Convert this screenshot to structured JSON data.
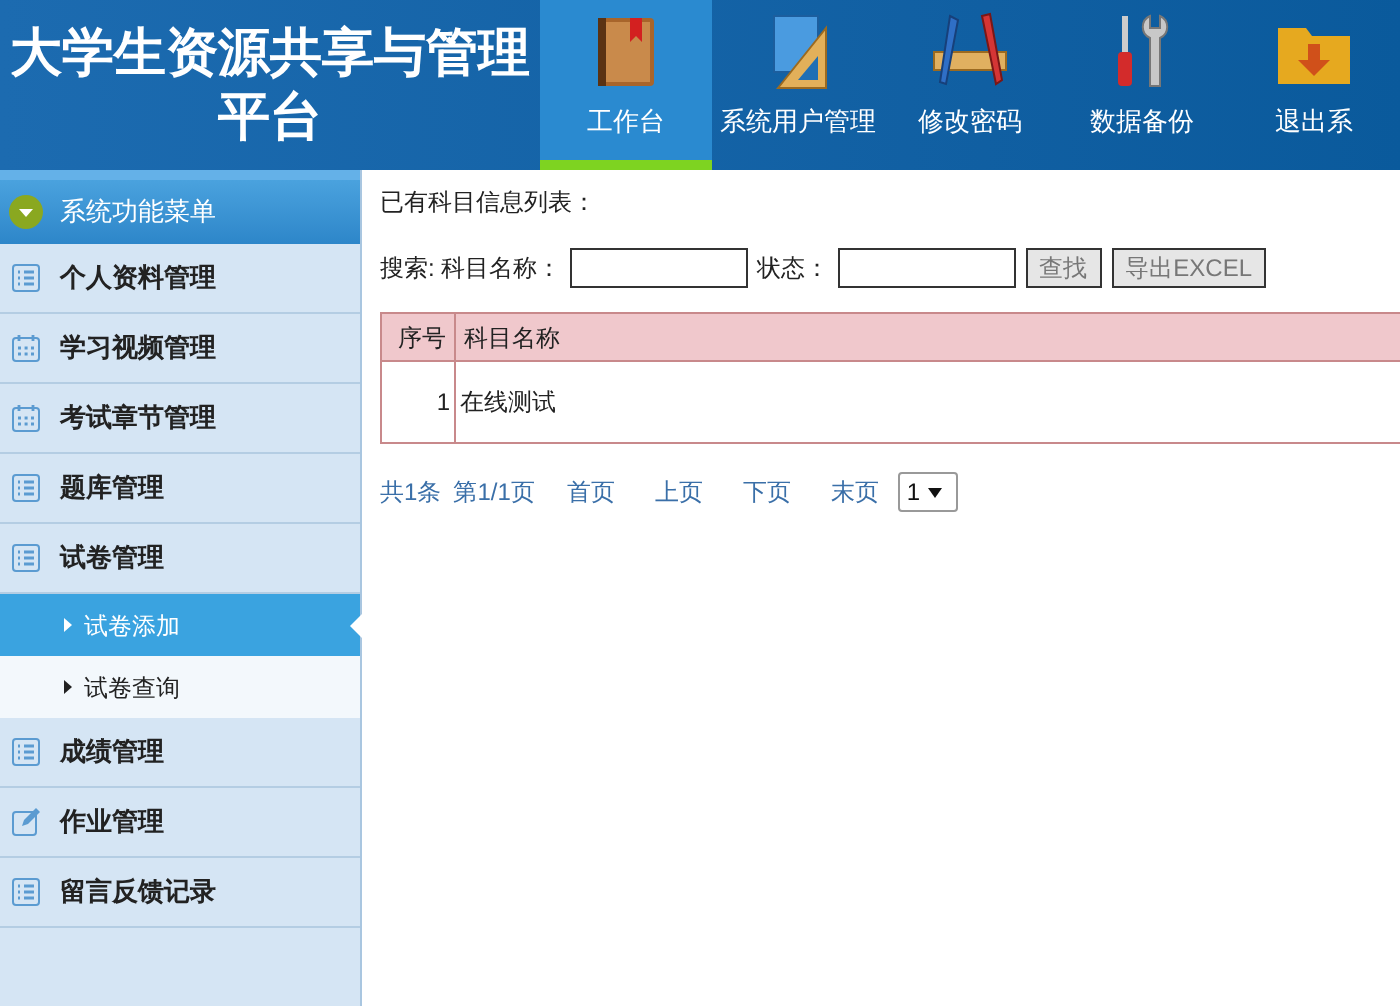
{
  "header": {
    "title_line1": "大学生资源共享与管理",
    "title_line2": "平台"
  },
  "nav": [
    {
      "label": "工作台",
      "selected": true
    },
    {
      "label": "系统用户管理",
      "selected": false
    },
    {
      "label": "修改密码",
      "selected": false
    },
    {
      "label": "数据备份",
      "selected": false
    },
    {
      "label": "退出系",
      "selected": false
    }
  ],
  "sidebar": {
    "title": "系统功能菜单",
    "items": [
      {
        "label": "个人资料管理",
        "kind": "list"
      },
      {
        "label": "学习视频管理",
        "kind": "calendar"
      },
      {
        "label": "考试章节管理",
        "kind": "calendar"
      },
      {
        "label": "题库管理",
        "kind": "list"
      },
      {
        "label": "试卷管理",
        "kind": "list",
        "children": [
          {
            "label": "试卷添加",
            "selected": true
          },
          {
            "label": "试卷查询",
            "selected": false
          }
        ]
      },
      {
        "label": "成绩管理",
        "kind": "list"
      },
      {
        "label": "作业管理",
        "kind": "edit"
      },
      {
        "label": "留言反馈记录",
        "kind": "list"
      }
    ]
  },
  "content": {
    "heading": "已有科目信息列表：",
    "search_label": "搜索: 科目名称：",
    "status_label": "状态：",
    "buttons": [
      "查找",
      "导出EXCEL"
    ],
    "table": {
      "columns": [
        "序号",
        "科目名称"
      ],
      "rows": [
        [
          "1",
          "在线测试"
        ]
      ]
    },
    "pagination": {
      "total": "共1条",
      "page": "第1/1页",
      "links": [
        "首页",
        "上页",
        "下页",
        "末页"
      ],
      "select": "1"
    }
  }
}
